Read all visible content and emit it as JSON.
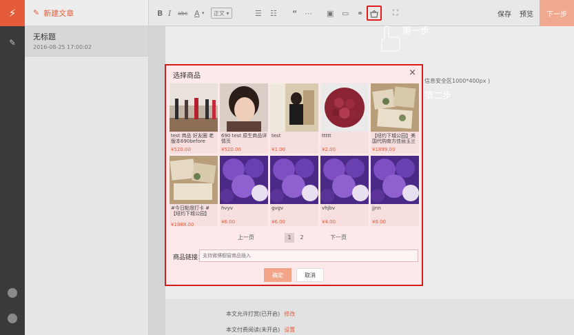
{
  "sidebar": {
    "new_article": "新建文章",
    "article_title": "无标题",
    "article_date": "2016-08-25 17:00:02"
  },
  "toolbar": {
    "font_label": "正文",
    "save": "保存",
    "preview": "预览",
    "next": "下一步"
  },
  "annotations": {
    "step1": "第一步",
    "step2": "第二步",
    "cover_hint": "信息安全区1000*400px )"
  },
  "modal": {
    "title": "选择商品",
    "close": "×",
    "products": [
      {
        "name": "test 商品 好友圈 老版本690before",
        "price": "¥520.00"
      },
      {
        "name": "690 test 原生商品详情页",
        "price": "¥520.00"
      },
      {
        "name": "test",
        "price": "¥1.00"
      },
      {
        "name": "ttttt",
        "price": "¥2.00"
      },
      {
        "name": "【纽约下城公园】美国代购南方佳丽玉兰",
        "price": "¥1899.00"
      },
      {
        "name": "#今日點燈打卡 #【纽约下城公园】",
        "price": "¥1988.00"
      },
      {
        "name": "hvyv",
        "price": "¥6.00"
      },
      {
        "name": "gvgv",
        "price": "¥6.00"
      },
      {
        "name": "vhjbv",
        "price": "¥4.00"
      },
      {
        "name": "jjnn",
        "price": "¥8.00"
      }
    ],
    "pager": {
      "prev": "上一页",
      "page1": "1",
      "page2": "2",
      "next": "下一页"
    },
    "link_label": "商品链接：",
    "link_placeholder": "支持微博橱窗商品插入",
    "confirm": "确定",
    "cancel": "取消"
  },
  "footer": {
    "reward_text": "本文允许打赏(已开启)",
    "reward_link": "修改",
    "paid_text": "本文付费阅读(未开启)",
    "paid_link": "设置"
  }
}
